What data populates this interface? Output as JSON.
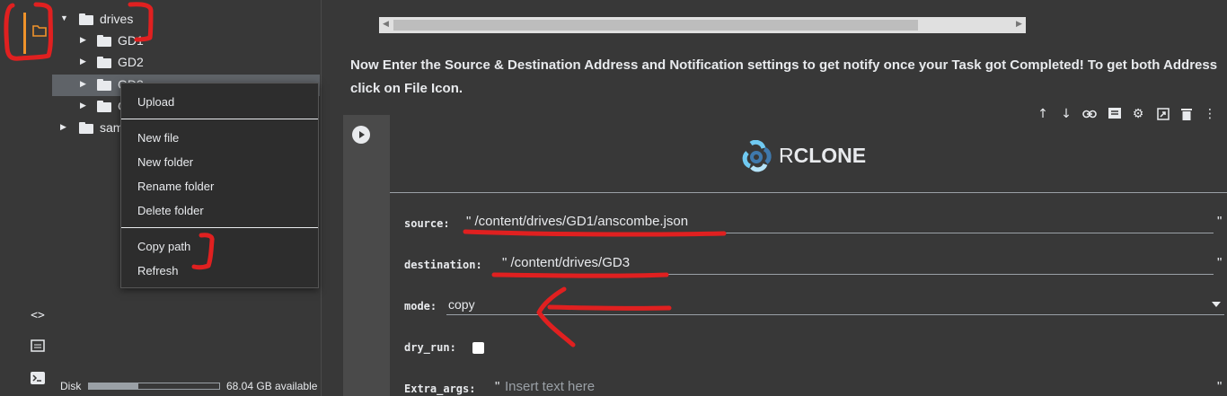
{
  "sidebar": {
    "tree": [
      {
        "label": "drives",
        "expanded": true
      },
      {
        "label": "GD1"
      },
      {
        "label": "GD2"
      },
      {
        "label": "GD3"
      },
      {
        "label": "G"
      },
      {
        "label": "sam"
      }
    ],
    "disk": {
      "label": "Disk",
      "available": "68.04 GB available",
      "used_fraction": 0.38
    }
  },
  "context_menu": {
    "items": [
      "Upload",
      "New file",
      "New folder",
      "Rename folder",
      "Delete folder",
      "Copy path",
      "Refresh"
    ]
  },
  "notebook": {
    "markdown": "Now Enter the Source & Destination Address and Notification settings to get notify once your Task got Completed! To get both Address click on File Icon.",
    "logo_text_light": "R",
    "logo_text_bold": "CLONE",
    "fields": {
      "source": {
        "label": "source:",
        "value": "\" /content/drives/GD1/anscombe.json",
        "end": "\""
      },
      "destination": {
        "label": "destination:",
        "value": "\" /content/drives/GD3",
        "end": "\""
      },
      "mode": {
        "label": "mode:",
        "value": "copy"
      },
      "dry_run": {
        "label": "dry_run:",
        "checked": false
      },
      "extra_args": {
        "label": "Extra_args:",
        "quote": "\"",
        "placeholder": "Insert text here",
        "end": "\""
      }
    }
  },
  "toolbar_icons": [
    "arrow-up-icon",
    "arrow-down-icon",
    "link-icon",
    "comment-icon",
    "settings-icon",
    "mirror-cell-icon",
    "delete-icon",
    "more-icon"
  ],
  "colors": {
    "accent": "#f0932b",
    "annotation": "#e02020",
    "background": "#383838"
  }
}
